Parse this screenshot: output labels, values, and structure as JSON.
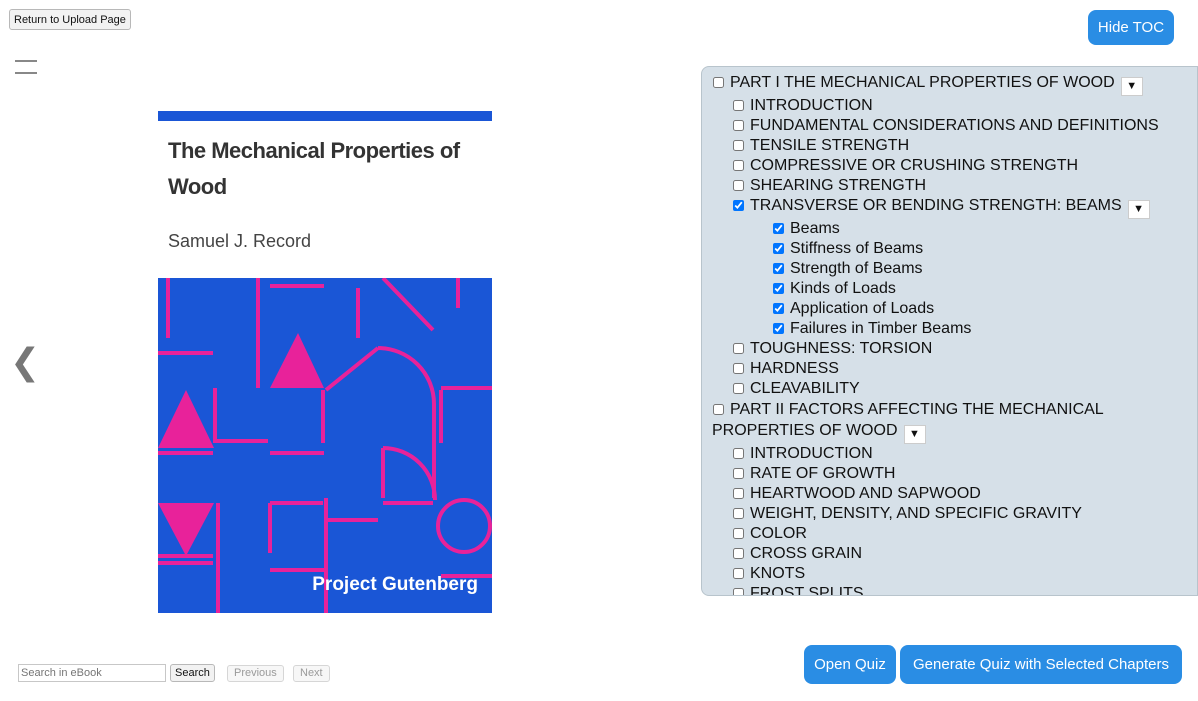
{
  "header": {
    "return_label": "Return to Upload Page",
    "hide_toc_label": "Hide TOC"
  },
  "cover": {
    "title": "The Mechanical Properties of Wood",
    "author": "Samuel J. Record",
    "publisher": "Project Gutenberg",
    "colors": {
      "background": "#1a56d6",
      "accent": "#e8229a"
    }
  },
  "nav": {
    "prev_icon": "chevron-left-icon",
    "prev_glyph": "❮"
  },
  "toc": {
    "toggle_glyph": "▼",
    "parts": [
      {
        "label": "PART I THE MECHANICAL PROPERTIES OF WOOD",
        "checked": false,
        "chapters": [
          {
            "label": "INTRODUCTION",
            "checked": false
          },
          {
            "label": "FUNDAMENTAL CONSIDERATIONS AND DEFINITIONS",
            "checked": false
          },
          {
            "label": "TENSILE STRENGTH",
            "checked": false
          },
          {
            "label": "COMPRESSIVE OR CRUSHING STRENGTH",
            "checked": false
          },
          {
            "label": "SHEARING STRENGTH",
            "checked": false
          },
          {
            "label": "TRANSVERSE OR BENDING STRENGTH: BEAMS",
            "checked": true,
            "sections": [
              {
                "label": "Beams",
                "checked": true
              },
              {
                "label": "Stiffness of Beams",
                "checked": true
              },
              {
                "label": "Strength of Beams",
                "checked": true
              },
              {
                "label": "Kinds of Loads",
                "checked": true
              },
              {
                "label": "Application of Loads",
                "checked": true
              },
              {
                "label": "Failures in Timber Beams",
                "checked": true
              }
            ]
          },
          {
            "label": "TOUGHNESS: TORSION",
            "checked": false
          },
          {
            "label": "HARDNESS",
            "checked": false
          },
          {
            "label": "CLEAVABILITY",
            "checked": false
          }
        ]
      },
      {
        "label": "PART II FACTORS AFFECTING THE MECHANICAL PROPERTIES OF WOOD",
        "checked": false,
        "chapters": [
          {
            "label": "INTRODUCTION",
            "checked": false
          },
          {
            "label": "RATE OF GROWTH",
            "checked": false
          },
          {
            "label": "HEARTWOOD AND SAPWOOD",
            "checked": false
          },
          {
            "label": "WEIGHT, DENSITY, AND SPECIFIC GRAVITY",
            "checked": false
          },
          {
            "label": "COLOR",
            "checked": false
          },
          {
            "label": "CROSS GRAIN",
            "checked": false
          },
          {
            "label": "KNOTS",
            "checked": false
          },
          {
            "label": "FROST SPLITS",
            "checked": false
          }
        ]
      }
    ]
  },
  "footer": {
    "search_placeholder": "Search in eBook",
    "search_label": "Search",
    "previous_label": "Previous",
    "next_label": "Next",
    "open_quiz_label": "Open Quiz",
    "generate_quiz_label": "Generate Quiz with Selected Chapters"
  }
}
